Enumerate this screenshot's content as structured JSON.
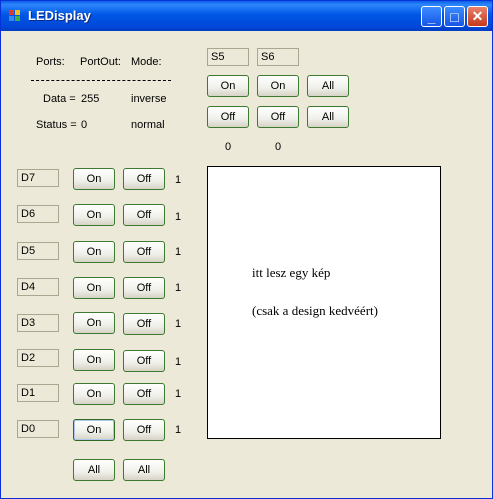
{
  "window": {
    "title": "LEDisplay",
    "icon": "app-icon",
    "minimize": "_",
    "maximize": "□",
    "close": "✕"
  },
  "header": {
    "ports_label": "Ports:",
    "portout_label": "PortOut:",
    "mode_label": "Mode:",
    "data_label": "Data =",
    "data_value": "255",
    "data_mode": "inverse",
    "status_label": "Status =",
    "status_value": "0",
    "status_mode": "normal"
  },
  "status_bits": [
    {
      "name": "S5",
      "on": "On",
      "off": "Off",
      "value": "0"
    },
    {
      "name": "S6",
      "on": "On",
      "off": "Off",
      "value": "0"
    }
  ],
  "status_all": {
    "on": "All",
    "off": "All"
  },
  "data_bits": [
    {
      "name": "D7",
      "on": "On",
      "off": "Off",
      "value": "1"
    },
    {
      "name": "D6",
      "on": "On",
      "off": "Off",
      "value": "1"
    },
    {
      "name": "D5",
      "on": "On",
      "off": "Off",
      "value": "1"
    },
    {
      "name": "D4",
      "on": "On",
      "off": "Off",
      "value": "1"
    },
    {
      "name": "D3",
      "on": "On",
      "off": "Off",
      "value": "1"
    },
    {
      "name": "D2",
      "on": "On",
      "off": "Off",
      "value": "1"
    },
    {
      "name": "D1",
      "on": "On",
      "off": "Off",
      "value": "1"
    },
    {
      "name": "D0",
      "on": "On",
      "off": "Off",
      "value": "1"
    }
  ],
  "data_all": {
    "on": "All",
    "off": "All"
  },
  "picture": {
    "line1": "itt lesz egy kép",
    "line2": "(csak a design kedvéért)"
  },
  "colors": {
    "title_bar": "#0057E5",
    "form_bg": "#ECE9D8",
    "button_border": "#3B7A2F",
    "textbox_border": "#A8A790"
  }
}
